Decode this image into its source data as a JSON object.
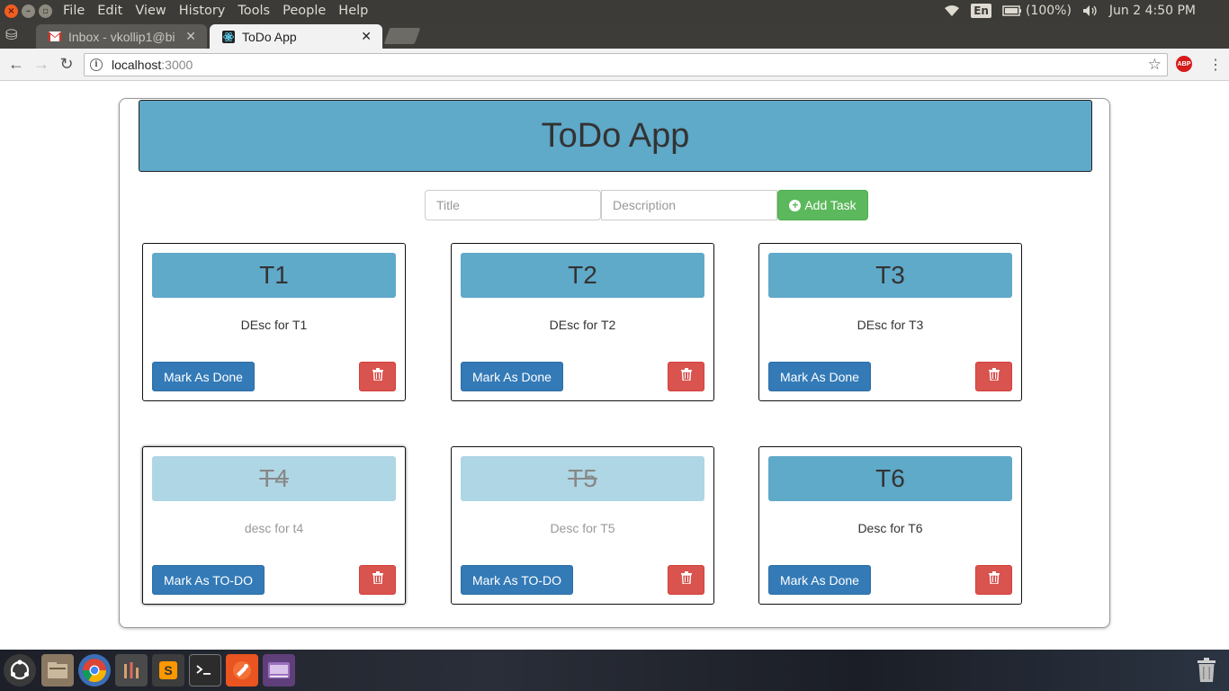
{
  "system_bar": {
    "menus": [
      "File",
      "Edit",
      "View",
      "History",
      "Tools",
      "People",
      "Help"
    ],
    "lang": "En",
    "battery": "(100%)",
    "clock": "Jun 2  4:50 PM"
  },
  "browser": {
    "tabs": [
      {
        "title": "Inbox - vkollip1@bi",
        "favicon": "gmail-icon"
      },
      {
        "title": "ToDo App",
        "favicon": "react-icon"
      }
    ],
    "url_host": "localhost",
    "url_port": ":3000"
  },
  "app": {
    "title": "ToDo App",
    "form": {
      "title_placeholder": "Title",
      "description_placeholder": "Description",
      "add_label": "Add Task"
    },
    "tasks": [
      {
        "title": "T1",
        "desc": "DEsc for T1",
        "action": "Mark As Done",
        "done": false
      },
      {
        "title": "T2",
        "desc": "DEsc for T2",
        "action": "Mark As Done",
        "done": false
      },
      {
        "title": "T3",
        "desc": "DEsc for T3",
        "action": "Mark As Done",
        "done": false
      },
      {
        "title": "T4",
        "desc": "desc for t4",
        "action": "Mark As TO-DO",
        "done": true
      },
      {
        "title": "T5",
        "desc": "Desc for T5",
        "action": "Mark As TO-DO",
        "done": true
      },
      {
        "title": "T6",
        "desc": "Desc for T6",
        "action": "Mark As Done",
        "done": false
      }
    ]
  },
  "colors": {
    "header": "#5fa9c9",
    "done_header": "#afd6e4",
    "primary": "#337ab7",
    "danger": "#d9534f",
    "success": "#5cb85c"
  }
}
